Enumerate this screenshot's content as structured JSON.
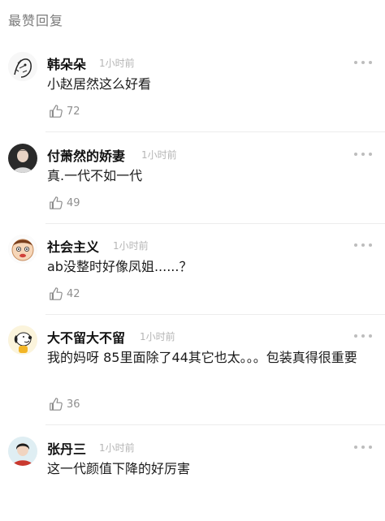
{
  "header": {
    "title": "最赞回复"
  },
  "comments": [
    {
      "user": "韩朵朵",
      "time": "1小时前",
      "text": "小赵居然这么好看",
      "likes": "72",
      "avatar_icon": "sketch-avatar-icon"
    },
    {
      "user": "付萧然的娇妻",
      "time": "1小时前",
      "text": "真.一代不如一代",
      "likes": "49",
      "avatar_icon": "woman-portrait-avatar-icon"
    },
    {
      "user": "社会主义",
      "time": "1小时前",
      "text": "ab没整时好像凤姐......？",
      "likes": "42",
      "avatar_icon": "cartoon-face-avatar-icon"
    },
    {
      "user": "大不留大不留",
      "time": "1小时前",
      "text": "我的妈呀 85里面除了44其它也太。。。包装真得很重要",
      "likes": "36",
      "avatar_icon": "snoopy-avatar-icon"
    },
    {
      "user": "张丹三",
      "time": "1小时前",
      "text": "这一代颜值下降的好厉害",
      "likes": "",
      "avatar_icon": "girl-portrait-avatar-icon"
    }
  ],
  "icons": {
    "like": "thumbs-up-icon",
    "more": "more-dots-icon"
  }
}
